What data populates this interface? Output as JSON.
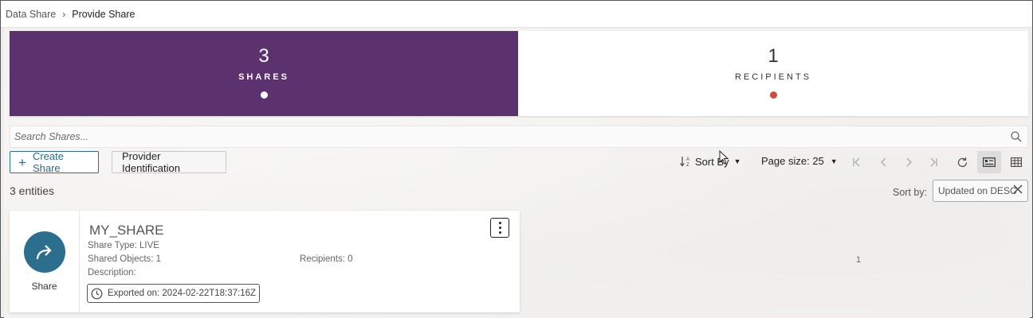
{
  "breadcrumb": {
    "parent": "Data Share",
    "current": "Provide Share"
  },
  "summary": {
    "shares": {
      "count": "3",
      "label": "SHARES"
    },
    "recipients": {
      "count": "1",
      "label": "RECIPIENTS"
    }
  },
  "search": {
    "placeholder": "Search Shares..."
  },
  "toolbar": {
    "create_label": "Create Share",
    "provider_label": "Provider Identification",
    "sort_label": "Sort By",
    "page_size_label": "Page size: 25"
  },
  "list": {
    "entities": "3 entities",
    "sort_by_label": "Sort by:",
    "sort_chip": "Updated on DESC",
    "page_number": "1"
  },
  "card": {
    "icon_label": "Share",
    "name": "MY_SHARE",
    "share_type": "Share Type: LIVE",
    "shared_objects": "Shared Objects: 1",
    "recipients": "Recipients: 0",
    "description": "Description:",
    "exported": "Exported on: 2024-02-22T18:37:16Z"
  },
  "colors": {
    "shares_tile": "#5b326e",
    "accent": "#2b6e8e",
    "recipient_dot": "#d04a43"
  }
}
